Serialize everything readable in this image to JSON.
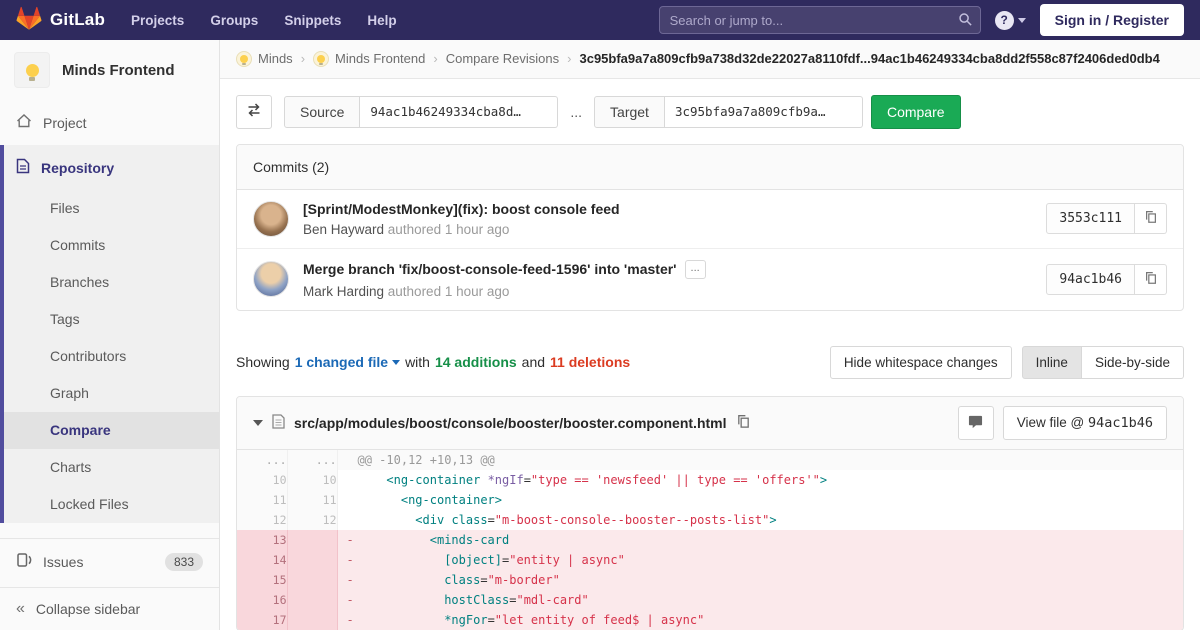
{
  "nav": {
    "brand": "GitLab",
    "links": [
      "Projects",
      "Groups",
      "Snippets",
      "Help"
    ],
    "search_placeholder": "Search or jump to...",
    "sign_in": "Sign in / Register"
  },
  "sidebar": {
    "project_title": "Minds Frontend",
    "project_item": "Project",
    "repository": {
      "label": "Repository",
      "items": [
        {
          "label": "Files",
          "active": false
        },
        {
          "label": "Commits",
          "active": false
        },
        {
          "label": "Branches",
          "active": false
        },
        {
          "label": "Tags",
          "active": false
        },
        {
          "label": "Contributors",
          "active": false
        },
        {
          "label": "Graph",
          "active": false
        },
        {
          "label": "Compare",
          "active": true
        },
        {
          "label": "Charts",
          "active": false
        },
        {
          "label": "Locked Files",
          "active": false
        }
      ]
    },
    "issues": {
      "label": "Issues",
      "count": "833"
    },
    "collapse": "Collapse sidebar"
  },
  "breadcrumb": {
    "items": [
      {
        "label": "Minds",
        "avatar": true
      },
      {
        "label": "Minds Frontend",
        "avatar": true
      },
      {
        "label": "Compare Revisions",
        "avatar": false
      }
    ],
    "current": "3c95bfa9a7a809cfb9a738d32de22027a8110fdf...94ac1b46249334cba8dd2f558c87f2406ded0db4"
  },
  "compare_form": {
    "source_label": "Source",
    "source_value": "94ac1b46249334cba8d…",
    "separator": "...",
    "target_label": "Target",
    "target_value": "3c95bfa9a7a809cfb9a…",
    "submit": "Compare"
  },
  "commits_panel": {
    "title": "Commits (2)",
    "expand_label": "...",
    "commits": [
      {
        "title": "[Sprint/ModestMonkey](fix): boost console feed",
        "author": "Ben Hayward",
        "meta": "authored 1 hour ago",
        "sha": "3553c111",
        "expand": false
      },
      {
        "title": "Merge branch 'fix/boost-console-feed-1596' into 'master'",
        "author": "Mark Harding",
        "meta": "authored 1 hour ago",
        "sha": "94ac1b46",
        "expand": true
      }
    ]
  },
  "diff_summary": {
    "showing": "Showing",
    "changed_files": "1 changed file",
    "with_text": "with",
    "additions": "14 additions",
    "and_text": "and",
    "deletions": "11 deletions",
    "hide_whitespace": "Hide whitespace changes",
    "inline": "Inline",
    "side_by_side": "Side-by-side"
  },
  "diff_file": {
    "path": "src/app/modules/boost/console/booster/booster.component.html",
    "view_file_prefix": "View file @",
    "view_file_sha": "94ac1b46",
    "removed_sign": "-",
    "lines": [
      {
        "kind": "match",
        "old": "...",
        "new": "...",
        "text": "@@ -10,12 +10,13 @@"
      },
      {
        "kind": "context",
        "old": "10",
        "new": "10",
        "tokens": [
          [
            "p",
            "    "
          ],
          [
            "t",
            "<ng-container"
          ],
          [
            "p",
            " "
          ],
          [
            "x",
            "*ngIf"
          ],
          [
            "p",
            "="
          ],
          [
            "s",
            "\"type == 'newsfeed' || type == 'offers'\""
          ],
          [
            "t",
            ">"
          ]
        ]
      },
      {
        "kind": "context",
        "old": "11",
        "new": "11",
        "tokens": [
          [
            "p",
            "      "
          ],
          [
            "t",
            "<ng-container>"
          ]
        ]
      },
      {
        "kind": "context",
        "old": "12",
        "new": "12",
        "tokens": [
          [
            "p",
            "        "
          ],
          [
            "t",
            "<div"
          ],
          [
            "p",
            " "
          ],
          [
            "a",
            "class"
          ],
          [
            "p",
            "="
          ],
          [
            "s",
            "\"m-boost-console--booster--posts-list\""
          ],
          [
            "t",
            ">"
          ]
        ]
      },
      {
        "kind": "old",
        "old": "13",
        "new": "",
        "tokens": [
          [
            "p",
            "          "
          ],
          [
            "t",
            "<minds-card"
          ]
        ]
      },
      {
        "kind": "old",
        "old": "14",
        "new": "",
        "tokens": [
          [
            "p",
            "            "
          ],
          [
            "a",
            "[object]"
          ],
          [
            "p",
            "="
          ],
          [
            "s",
            "\"entity | async\""
          ]
        ]
      },
      {
        "kind": "old",
        "old": "15",
        "new": "",
        "tokens": [
          [
            "p",
            "            "
          ],
          [
            "a",
            "class"
          ],
          [
            "p",
            "="
          ],
          [
            "s",
            "\"m-border\""
          ]
        ]
      },
      {
        "kind": "old",
        "old": "16",
        "new": "",
        "tokens": [
          [
            "p",
            "            "
          ],
          [
            "a",
            "hostClass"
          ],
          [
            "p",
            "="
          ],
          [
            "s",
            "\"mdl-card\""
          ]
        ]
      },
      {
        "kind": "old",
        "old": "17",
        "new": "",
        "tokens": [
          [
            "p",
            "            "
          ],
          [
            "a",
            "*ngFor"
          ],
          [
            "p",
            "="
          ],
          [
            "s",
            "\"let entity of feed$ | async\""
          ]
        ]
      }
    ]
  },
  "colors": {
    "navbar_bg": "#2f2a5e",
    "accent_green": "#1aaa55",
    "link_blue": "#1b69b6",
    "additions_green": "#168f48",
    "deletions_red": "#db3b21",
    "sidebar_active_indigo": "#39357e",
    "removed_line_bg": "#fbe9eb",
    "removed_gutter_bg": "#f9d7dc",
    "code_tag_teal": "#008080",
    "code_attr_purple": "#795da3",
    "code_string_red": "#d6324a"
  },
  "icons": {
    "logo": "gitlab-tanuki",
    "search": "magnifier",
    "help": "question-circle",
    "caret": "chevron-down",
    "swap": "swap-arrows",
    "copy": "copy-duplicate",
    "comment": "speech-bubble",
    "collapse": "double-chevron-left",
    "project": "home",
    "repository": "document",
    "issues": "issue-board",
    "avatar": "lightbulb"
  }
}
